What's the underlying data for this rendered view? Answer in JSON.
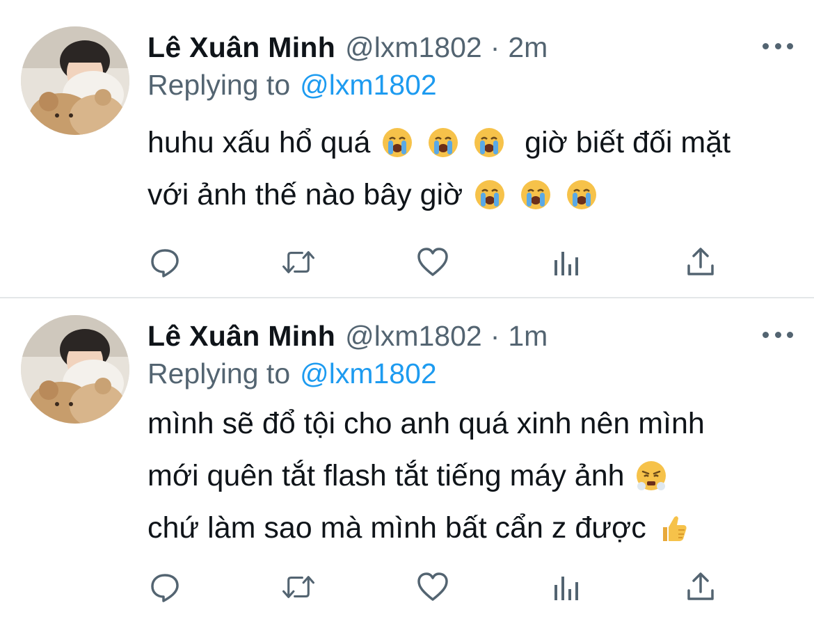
{
  "colors": {
    "primary_text": "#0f1419",
    "secondary_text": "#536471",
    "link": "#1d9bf0",
    "divider": "#e3e6e8",
    "background": "#ffffff"
  },
  "tweets": [
    {
      "author_name": "Lê Xuân Minh",
      "handle": "@lxm1802",
      "separator": "·",
      "time": "2m",
      "replying_prefix": "Replying to",
      "replying_handle": "@lxm1802",
      "lines": [
        {
          "text_before": "huhu xấu hổ quá",
          "emojis": [
            "loudly-crying-face",
            "loudly-crying-face",
            "loudly-crying-face"
          ],
          "text_after": "giờ biết đối mặt"
        },
        {
          "text_before": "với ảnh thế nào bây giờ",
          "emojis": [
            "loudly-crying-face",
            "loudly-crying-face",
            "loudly-crying-face"
          ],
          "text_after": ""
        }
      ],
      "actions": [
        "reply-icon",
        "retweet-icon",
        "like-icon",
        "analytics-icon",
        "share-icon"
      ]
    },
    {
      "author_name": "Lê Xuân Minh",
      "handle": "@lxm1802",
      "separator": "·",
      "time": "1m",
      "replying_prefix": "Replying to",
      "replying_handle": "@lxm1802",
      "lines": [
        {
          "text_before": "mình sẽ đổ tội cho anh quá xinh nên mình",
          "emojis": [],
          "text_after": ""
        },
        {
          "text_before": "mới quên tắt flash tắt tiếng máy ảnh",
          "emojis": [
            "face-with-steam-from-nose"
          ],
          "text_after": ""
        },
        {
          "text_before": "chứ làm sao mà mình bất cẩn z được",
          "emojis": [
            "thumbs-up"
          ],
          "text_after": ""
        }
      ],
      "actions": [
        "reply-icon",
        "retweet-icon",
        "like-icon",
        "analytics-icon",
        "share-icon"
      ]
    }
  ]
}
